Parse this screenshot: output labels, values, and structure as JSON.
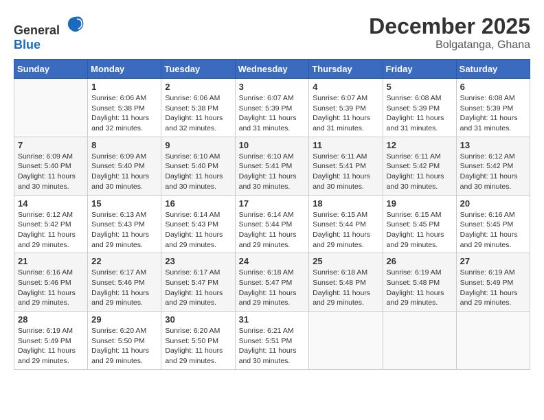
{
  "header": {
    "logo_general": "General",
    "logo_blue": "Blue",
    "month_year": "December 2025",
    "location": "Bolgatanga, Ghana"
  },
  "weekdays": [
    "Sunday",
    "Monday",
    "Tuesday",
    "Wednesday",
    "Thursday",
    "Friday",
    "Saturday"
  ],
  "weeks": [
    [
      {
        "day": "",
        "sunrise": "",
        "sunset": "",
        "daylight": ""
      },
      {
        "day": "1",
        "sunrise": "Sunrise: 6:06 AM",
        "sunset": "Sunset: 5:38 PM",
        "daylight": "Daylight: 11 hours and 32 minutes."
      },
      {
        "day": "2",
        "sunrise": "Sunrise: 6:06 AM",
        "sunset": "Sunset: 5:38 PM",
        "daylight": "Daylight: 11 hours and 32 minutes."
      },
      {
        "day": "3",
        "sunrise": "Sunrise: 6:07 AM",
        "sunset": "Sunset: 5:39 PM",
        "daylight": "Daylight: 11 hours and 31 minutes."
      },
      {
        "day": "4",
        "sunrise": "Sunrise: 6:07 AM",
        "sunset": "Sunset: 5:39 PM",
        "daylight": "Daylight: 11 hours and 31 minutes."
      },
      {
        "day": "5",
        "sunrise": "Sunrise: 6:08 AM",
        "sunset": "Sunset: 5:39 PM",
        "daylight": "Daylight: 11 hours and 31 minutes."
      },
      {
        "day": "6",
        "sunrise": "Sunrise: 6:08 AM",
        "sunset": "Sunset: 5:39 PM",
        "daylight": "Daylight: 11 hours and 31 minutes."
      }
    ],
    [
      {
        "day": "7",
        "sunrise": "Sunrise: 6:09 AM",
        "sunset": "Sunset: 5:40 PM",
        "daylight": "Daylight: 11 hours and 30 minutes."
      },
      {
        "day": "8",
        "sunrise": "Sunrise: 6:09 AM",
        "sunset": "Sunset: 5:40 PM",
        "daylight": "Daylight: 11 hours and 30 minutes."
      },
      {
        "day": "9",
        "sunrise": "Sunrise: 6:10 AM",
        "sunset": "Sunset: 5:40 PM",
        "daylight": "Daylight: 11 hours and 30 minutes."
      },
      {
        "day": "10",
        "sunrise": "Sunrise: 6:10 AM",
        "sunset": "Sunset: 5:41 PM",
        "daylight": "Daylight: 11 hours and 30 minutes."
      },
      {
        "day": "11",
        "sunrise": "Sunrise: 6:11 AM",
        "sunset": "Sunset: 5:41 PM",
        "daylight": "Daylight: 11 hours and 30 minutes."
      },
      {
        "day": "12",
        "sunrise": "Sunrise: 6:11 AM",
        "sunset": "Sunset: 5:42 PM",
        "daylight": "Daylight: 11 hours and 30 minutes."
      },
      {
        "day": "13",
        "sunrise": "Sunrise: 6:12 AM",
        "sunset": "Sunset: 5:42 PM",
        "daylight": "Daylight: 11 hours and 30 minutes."
      }
    ],
    [
      {
        "day": "14",
        "sunrise": "Sunrise: 6:12 AM",
        "sunset": "Sunset: 5:42 PM",
        "daylight": "Daylight: 11 hours and 29 minutes."
      },
      {
        "day": "15",
        "sunrise": "Sunrise: 6:13 AM",
        "sunset": "Sunset: 5:43 PM",
        "daylight": "Daylight: 11 hours and 29 minutes."
      },
      {
        "day": "16",
        "sunrise": "Sunrise: 6:14 AM",
        "sunset": "Sunset: 5:43 PM",
        "daylight": "Daylight: 11 hours and 29 minutes."
      },
      {
        "day": "17",
        "sunrise": "Sunrise: 6:14 AM",
        "sunset": "Sunset: 5:44 PM",
        "daylight": "Daylight: 11 hours and 29 minutes."
      },
      {
        "day": "18",
        "sunrise": "Sunrise: 6:15 AM",
        "sunset": "Sunset: 5:44 PM",
        "daylight": "Daylight: 11 hours and 29 minutes."
      },
      {
        "day": "19",
        "sunrise": "Sunrise: 6:15 AM",
        "sunset": "Sunset: 5:45 PM",
        "daylight": "Daylight: 11 hours and 29 minutes."
      },
      {
        "day": "20",
        "sunrise": "Sunrise: 6:16 AM",
        "sunset": "Sunset: 5:45 PM",
        "daylight": "Daylight: 11 hours and 29 minutes."
      }
    ],
    [
      {
        "day": "21",
        "sunrise": "Sunrise: 6:16 AM",
        "sunset": "Sunset: 5:46 PM",
        "daylight": "Daylight: 11 hours and 29 minutes."
      },
      {
        "day": "22",
        "sunrise": "Sunrise: 6:17 AM",
        "sunset": "Sunset: 5:46 PM",
        "daylight": "Daylight: 11 hours and 29 minutes."
      },
      {
        "day": "23",
        "sunrise": "Sunrise: 6:17 AM",
        "sunset": "Sunset: 5:47 PM",
        "daylight": "Daylight: 11 hours and 29 minutes."
      },
      {
        "day": "24",
        "sunrise": "Sunrise: 6:18 AM",
        "sunset": "Sunset: 5:47 PM",
        "daylight": "Daylight: 11 hours and 29 minutes."
      },
      {
        "day": "25",
        "sunrise": "Sunrise: 6:18 AM",
        "sunset": "Sunset: 5:48 PM",
        "daylight": "Daylight: 11 hours and 29 minutes."
      },
      {
        "day": "26",
        "sunrise": "Sunrise: 6:19 AM",
        "sunset": "Sunset: 5:48 PM",
        "daylight": "Daylight: 11 hours and 29 minutes."
      },
      {
        "day": "27",
        "sunrise": "Sunrise: 6:19 AM",
        "sunset": "Sunset: 5:49 PM",
        "daylight": "Daylight: 11 hours and 29 minutes."
      }
    ],
    [
      {
        "day": "28",
        "sunrise": "Sunrise: 6:19 AM",
        "sunset": "Sunset: 5:49 PM",
        "daylight": "Daylight: 11 hours and 29 minutes."
      },
      {
        "day": "29",
        "sunrise": "Sunrise: 6:20 AM",
        "sunset": "Sunset: 5:50 PM",
        "daylight": "Daylight: 11 hours and 29 minutes."
      },
      {
        "day": "30",
        "sunrise": "Sunrise: 6:20 AM",
        "sunset": "Sunset: 5:50 PM",
        "daylight": "Daylight: 11 hours and 29 minutes."
      },
      {
        "day": "31",
        "sunrise": "Sunrise: 6:21 AM",
        "sunset": "Sunset: 5:51 PM",
        "daylight": "Daylight: 11 hours and 30 minutes."
      },
      {
        "day": "",
        "sunrise": "",
        "sunset": "",
        "daylight": ""
      },
      {
        "day": "",
        "sunrise": "",
        "sunset": "",
        "daylight": ""
      },
      {
        "day": "",
        "sunrise": "",
        "sunset": "",
        "daylight": ""
      }
    ]
  ]
}
